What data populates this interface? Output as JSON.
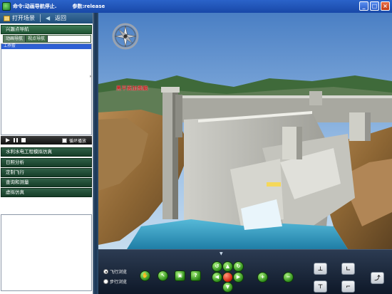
{
  "title_bar": {
    "command": "命令:动画导航停止.",
    "parameter": "参数:release",
    "buttons": {
      "minimize": "_",
      "maximize": "□",
      "close": "×"
    }
  },
  "left_panel": {
    "toolbar": {
      "open_scene": "打开场景",
      "back": "返回"
    },
    "section_header": "兴趣点导航",
    "nav_tabs": [
      "动画导航",
      "视点导航"
    ],
    "list_items": [
      "工作按"
    ],
    "playback": {
      "play": "▶",
      "pause": "❚❚",
      "stop": "■",
      "loop_label": "循环播放"
    },
    "menu_items": [
      "水利水电工程模拟仿真",
      "日照分析",
      "定制飞行",
      "查询和测量",
      "虚拟仿真"
    ]
  },
  "scene": {
    "label": "黑平面加图脑"
  },
  "bottom_toolbar": {
    "expand_arrow": "▼",
    "modes": [
      {
        "label": "飞行浏览",
        "selected": true
      },
      {
        "label": "步行浏览",
        "selected": false
      }
    ],
    "tool_icons": [
      "hand-icon",
      "pointer-icon",
      "window-icon",
      "help-icon"
    ],
    "nav_icons": [
      "arrow-up-icon",
      "arrow-down-icon",
      "arrow-left-icon",
      "arrow-right-icon",
      "rotate-left-icon",
      "rotate-right-icon",
      "center-stop-icon"
    ],
    "zoom_icons": [
      "zoom-in-icon",
      "zoom-out-icon"
    ],
    "view_icons": [
      "raise-view-icon",
      "lower-view-icon",
      "angle-up-icon",
      "angle-down-icon",
      "pitch-icon"
    ],
    "symbols": {
      "help": "?",
      "up": "▲",
      "down": "▼",
      "left": "◀",
      "right": "▶",
      "zoom_in": "+",
      "zoom_out": "−"
    }
  }
}
